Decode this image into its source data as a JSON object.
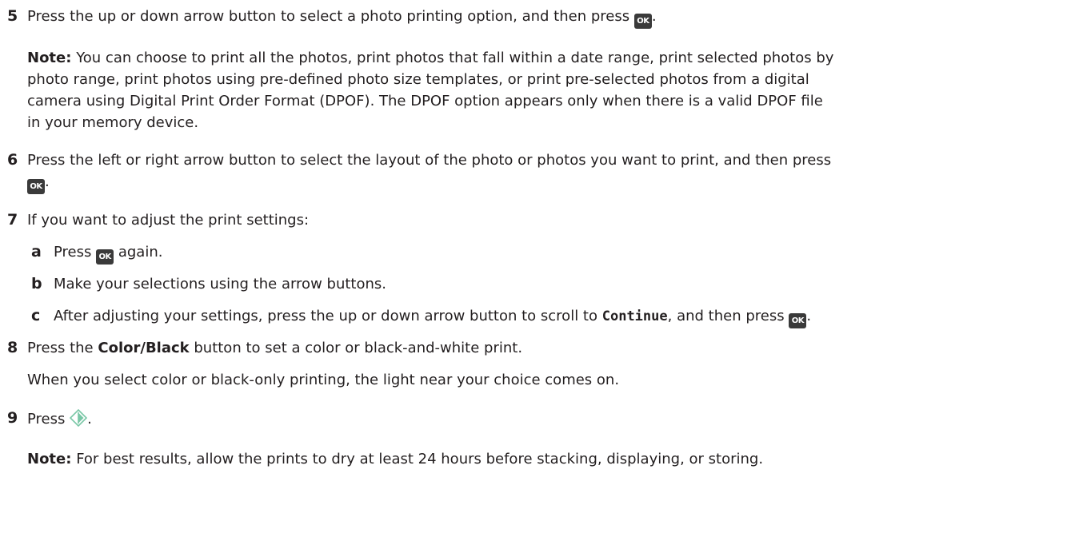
{
  "steps": {
    "s5": {
      "number": "5",
      "text_before": "Press the up or down arrow button to select a photo printing option, and then press",
      "text_after": ".",
      "note_label": "Note:",
      "note_lines": [
        "You can choose to print all the photos, print photos that fall within a date range, print selected photos by",
        "photo range, print photos using pre-defined photo size templates, or print pre-selected photos from a digital",
        "camera using Digital Print Order Format (DPOF). The DPOF option appears only when there is a valid DPOF file",
        "in your memory device."
      ]
    },
    "s6": {
      "number": "6",
      "line1": "Press the left or right arrow button to select the layout of the photo or photos you want to print, and then press",
      "line2_after": "."
    },
    "s7": {
      "number": "7",
      "text": "If you want to adjust the print settings:",
      "a": {
        "letter": "a",
        "before": "Press",
        "after": "again."
      },
      "b": {
        "letter": "b",
        "text": "Make your selections using the arrow buttons."
      },
      "c": {
        "letter": "c",
        "before": "After adjusting your settings, press the up or down arrow button to scroll to",
        "code": "Continue",
        "after": ", and then press",
        "end": "."
      }
    },
    "s8": {
      "number": "8",
      "before": "Press the",
      "bold": "Color/Black",
      "after": "button to set a color or black-and-white print.",
      "line2": "When you select color or black-only printing, the light near your choice comes on."
    },
    "s9": {
      "number": "9",
      "before": "Press",
      "after": ".",
      "note_label": "Note:",
      "note_text": "For best results, allow the prints to dry at least 24 hours before stacking, displaying, or storing."
    }
  },
  "icons": {
    "ok_label": "OK",
    "ok_icon": "ok-button-icon",
    "start_icon": "start-button-icon",
    "start_color": "#79c7a6"
  }
}
